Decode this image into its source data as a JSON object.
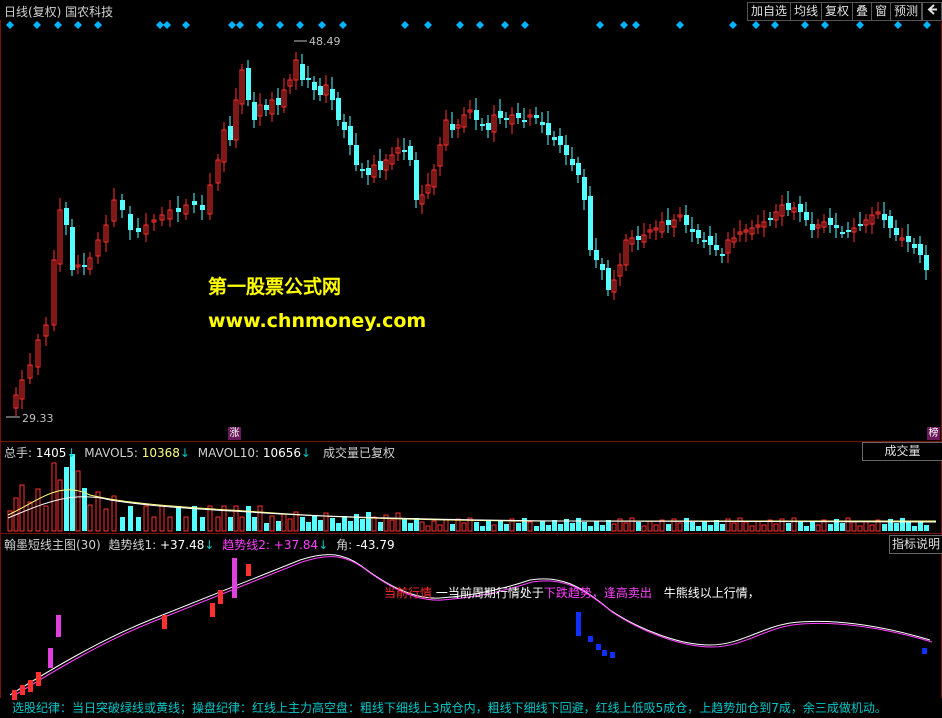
{
  "titlebar": {
    "title": "日线(复权)  国农科技",
    "buttons": [
      "加自选",
      "均线",
      "复权",
      "叠",
      "窗",
      "预测"
    ],
    "back_icon": "back-arrow-icon"
  },
  "price_panel": {
    "high_label": "48.49",
    "low_label": "29.33",
    "watermark_line1": "第一股票公式网",
    "watermark_line2": "www.chnmoney.com",
    "zhang_badge": "涨",
    "bang_badge": "榜"
  },
  "volume_panel": {
    "legend_total_label": "总手: ",
    "legend_total_value": "1405",
    "legend_mavol5_label": "MAVOL5: ",
    "legend_mavol5_value": "10368",
    "legend_mavol10_label": "MAVOL10: ",
    "legend_mavol10_value": "10656",
    "legend_note": "成交量已复权",
    "button": "成交量"
  },
  "indicator_panel": {
    "name": "翰墨短线主图(30)",
    "trend1_label": "趋势线1: ",
    "trend1_value": "+37.48",
    "trend2_label": "趋势线2: ",
    "trend2_value": "+37.84",
    "angle_label": "角: ",
    "angle_value": "-43.79",
    "button": "指标说明",
    "annotation_a": "当前行情",
    "annotation_b": "一当前周期行情处于",
    "annotation_c": "下跌趋势",
    "annotation_d": "，逢高卖出",
    "annotation_e": "牛熊线以上行情，",
    "footer": "选股纪律：当日突破绿线或黄线；操盘纪律：红线上主力高空盘：粗线下细线上3成仓内，粗线下细线下回避，红线上低吸5成仓，上趋势加仓到7成，余三成做机动。"
  },
  "colors": {
    "up_candle": "#ff3030",
    "down_candle": "#54ffff",
    "panel_border": "#7a1010",
    "diamond": "#00b4ff",
    "trend1": "#ffffff",
    "trend2": "#ff40ff",
    "watermark": "#ffff00"
  }
}
